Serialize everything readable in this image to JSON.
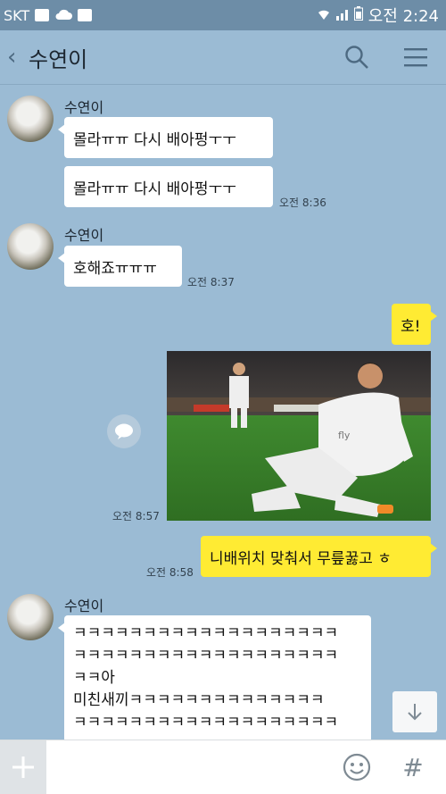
{
  "status_bar": {
    "carrier": "SKT",
    "time": "오전 2:24",
    "icons": [
      "facebook-icon",
      "cloud-icon",
      "download-icon",
      "wifi-icon",
      "signal-icon",
      "battery-icon"
    ]
  },
  "header": {
    "back_glyph": "‹",
    "chat_name": "수연이",
    "icons": [
      "search-icon",
      "menu-icon"
    ]
  },
  "messages": [
    {
      "sender": "수연이",
      "text": "몰라ㅠㅠ 다시 배아펑ㅜㅜ"
    },
    {
      "text": "몰라ㅠㅠ 다시 배아펑ㅜㅜ",
      "time": "오전 8:36"
    },
    {
      "sender": "수연이",
      "text": "호해죠ㅠㅠㅠ",
      "time": "오전 8:37"
    },
    {
      "me": true,
      "text": "호!"
    },
    {
      "me": true,
      "image": "football-player-kneeling-celebration",
      "time": "오전 8:57"
    },
    {
      "me": true,
      "text": "니배위치 맞춰서 무릎꿇고 ㅎ",
      "time": "오전 8:58"
    },
    {
      "sender": "수연이",
      "lines": [
        "ㅋㅋㅋㅋㅋㅋㅋㅋㅋㅋㅋㅋㅋㅋㅋㅋㅋㅋㅋ",
        "ㅋㅋㅋㅋㅋㅋㅋㅋㅋㅋㅋㅋㅋㅋㅋㅋㅋㅋㅋ",
        "ㅋㅋ아",
        "미친새끼ㅋㅋㅋㅋㅋㅋㅋㅋㅋㅋㅋㅋㅋㅋ",
        "ㅋㅋㅋㅋㅋㅋㅋㅋㅋㅋㅋㅋㅋㅋㅋㅋㅋㅋㅋ"
      ]
    }
  ],
  "input_bar": {
    "plus_glyph": "+",
    "hash_glyph": "#"
  },
  "colors": {
    "chat_background": "#9bbbd4",
    "my_bubble": "#ffeb33",
    "their_bubble": "#ffffff",
    "status_bar": "#6d8da7"
  }
}
